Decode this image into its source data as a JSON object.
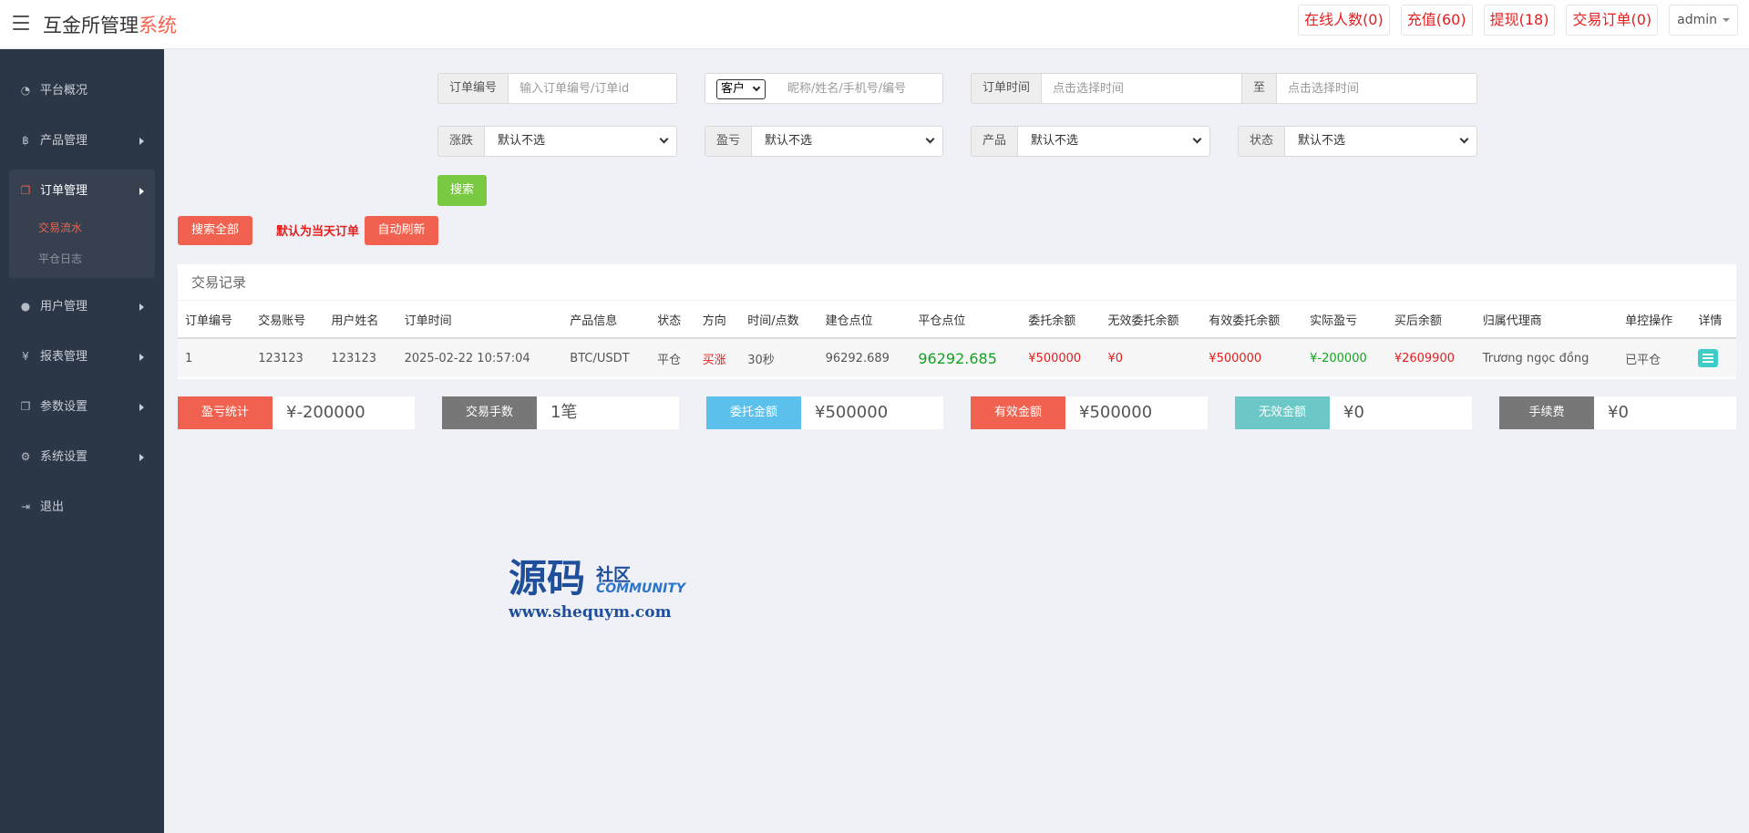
{
  "header": {
    "title_main": "互金所管理",
    "title_accent": "系统",
    "nav": [
      {
        "label": "在线人数(0)"
      },
      {
        "label": "充值(60)"
      },
      {
        "label": "提现(18)"
      },
      {
        "label": "交易订单(0)"
      }
    ],
    "user": "admin"
  },
  "sidebar": {
    "items": [
      {
        "label": "平台概况",
        "icon": "dashboard-icon"
      },
      {
        "label": "产品管理",
        "icon": "bitcoin-icon"
      },
      {
        "label": "订单管理",
        "icon": "copy-icon",
        "children": [
          {
            "label": "交易流水",
            "active": true
          },
          {
            "label": "平仓日志"
          }
        ]
      },
      {
        "label": "用户管理",
        "icon": "user-icon"
      },
      {
        "label": "报表管理",
        "icon": "yen-icon"
      },
      {
        "label": "参数设置",
        "icon": "copy-icon"
      },
      {
        "label": "系统设置",
        "icon": "gears-icon"
      },
      {
        "label": "退出",
        "icon": "sign-out-icon"
      }
    ]
  },
  "filters": {
    "order_no": {
      "label": "订单编号",
      "placeholder": "输入订单编号/订单id"
    },
    "customer": {
      "select_value": "客户",
      "placeholder": "昵称/姓名/手机号/编号"
    },
    "order_time": {
      "label": "订单时间",
      "placeholder_from": "点击选择时间",
      "to_label": "至",
      "placeholder_to": "点击选择时间"
    },
    "rise_fall": {
      "label": "涨跌",
      "value": "默认不选"
    },
    "profit_loss": {
      "label": "盈亏",
      "value": "默认不选"
    },
    "product": {
      "label": "产品",
      "value": "默认不选"
    },
    "status": {
      "label": "状态",
      "value": "默认不选"
    },
    "search_button": "搜索"
  },
  "actions": {
    "search_all": "搜索全部",
    "default_note": "默认为当天订单",
    "auto_refresh": "自动刷新"
  },
  "table": {
    "title": "交易记录",
    "columns": [
      "订单编号",
      "交易账号",
      "用户姓名",
      "订单时间",
      "产品信息",
      "状态",
      "方向",
      "时间/点数",
      "建仓点位",
      "平仓点位",
      "委托余额",
      "无效委托余额",
      "有效委托余额",
      "实际盈亏",
      "买后余额",
      "归属代理商",
      "单控操作",
      "详情"
    ],
    "rows": [
      {
        "order_no": "1",
        "account": "123123",
        "name": "123123",
        "time": "2025-02-22 10:57:04",
        "product": "BTC/USDT",
        "status": "平仓",
        "direction": "买涨",
        "duration": "30秒",
        "open_price": "96292.689",
        "close_price": "96292.685",
        "entrust": "¥500000",
        "invalid": "¥0",
        "valid": "¥500000",
        "pnl": "¥-200000",
        "after_balance": "¥2609900",
        "agent": "Trương ngọc đồng",
        "control": "已平仓"
      }
    ]
  },
  "stats": [
    {
      "label": "盈亏统计",
      "value": "¥-200000",
      "color": "#f0624f"
    },
    {
      "label": "交易手数",
      "value": "1笔",
      "color": "#777777"
    },
    {
      "label": "委托金额",
      "value": "¥500000",
      "color": "#5bc0eb"
    },
    {
      "label": "有效金额",
      "value": "¥500000",
      "color": "#f0624f"
    },
    {
      "label": "无效金额",
      "value": "¥0",
      "color": "#6cc8c7"
    },
    {
      "label": "手续费",
      "value": "¥0",
      "color": "#777777"
    }
  ],
  "watermark": {
    "main": "源码",
    "side": "社区",
    "side_en": "COMMUNITY",
    "url": "www.shequym.com"
  },
  "colors": {
    "accent": "#f0624f",
    "sidebar_bg": "#2b3646",
    "red_text": "#e41e1e",
    "green_text": "#11a51e",
    "search_green": "#7ac943"
  }
}
